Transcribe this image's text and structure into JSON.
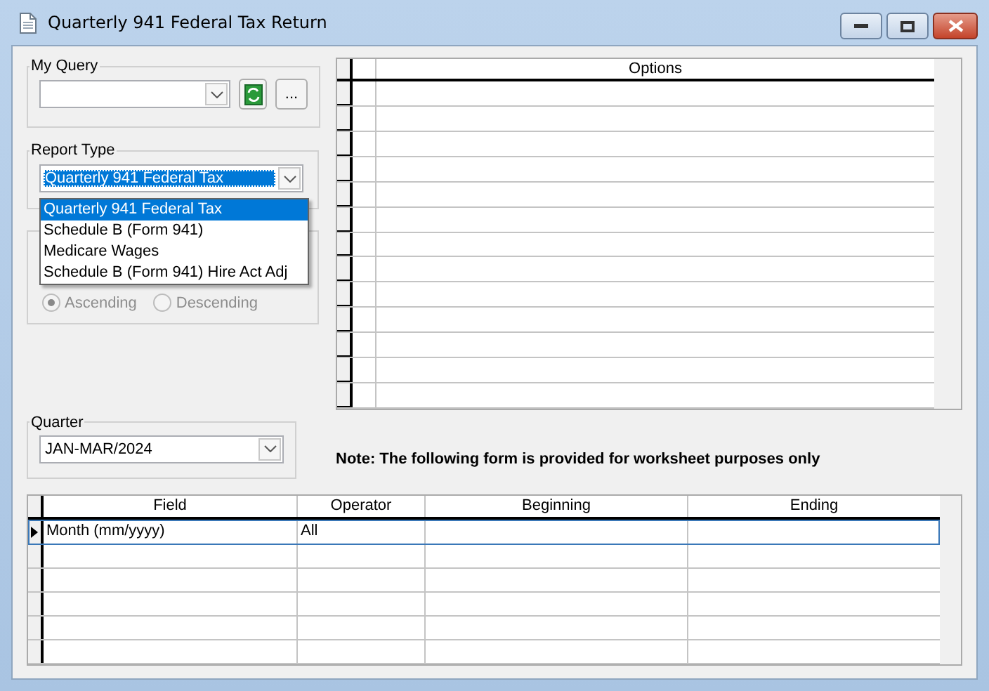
{
  "window": {
    "title": "Quarterly 941 Federal Tax Return"
  },
  "my_query": {
    "label": "My Query",
    "more_button": "..."
  },
  "report_type": {
    "label": "Report Type",
    "value": "Quarterly 941 Federal Tax",
    "open": true,
    "options": [
      {
        "label": "Quarterly 941 Federal Tax",
        "selected": true
      },
      {
        "label": "Schedule B (Form 941)",
        "selected": false
      },
      {
        "label": "Medicare Wages",
        "selected": false
      },
      {
        "label": "Schedule B (Form 941) Hire Act Adj",
        "selected": false
      }
    ]
  },
  "sort": {
    "radios": [
      {
        "label": "Ascending",
        "selected": true,
        "disabled": true
      },
      {
        "label": "Descending",
        "selected": false,
        "disabled": true
      }
    ]
  },
  "options_grid": {
    "columns": [
      "Options"
    ]
  },
  "quarter": {
    "label": "Quarter",
    "value": "JAN-MAR/2024"
  },
  "note": "Note: The following form is provided for worksheet purposes only",
  "criteria_grid": {
    "columns": [
      "Field",
      "Operator",
      "Beginning",
      "Ending"
    ],
    "rows": [
      {
        "cells": [
          "Month (mm/yyyy)",
          "All"
        ],
        "selected": true
      }
    ]
  }
}
